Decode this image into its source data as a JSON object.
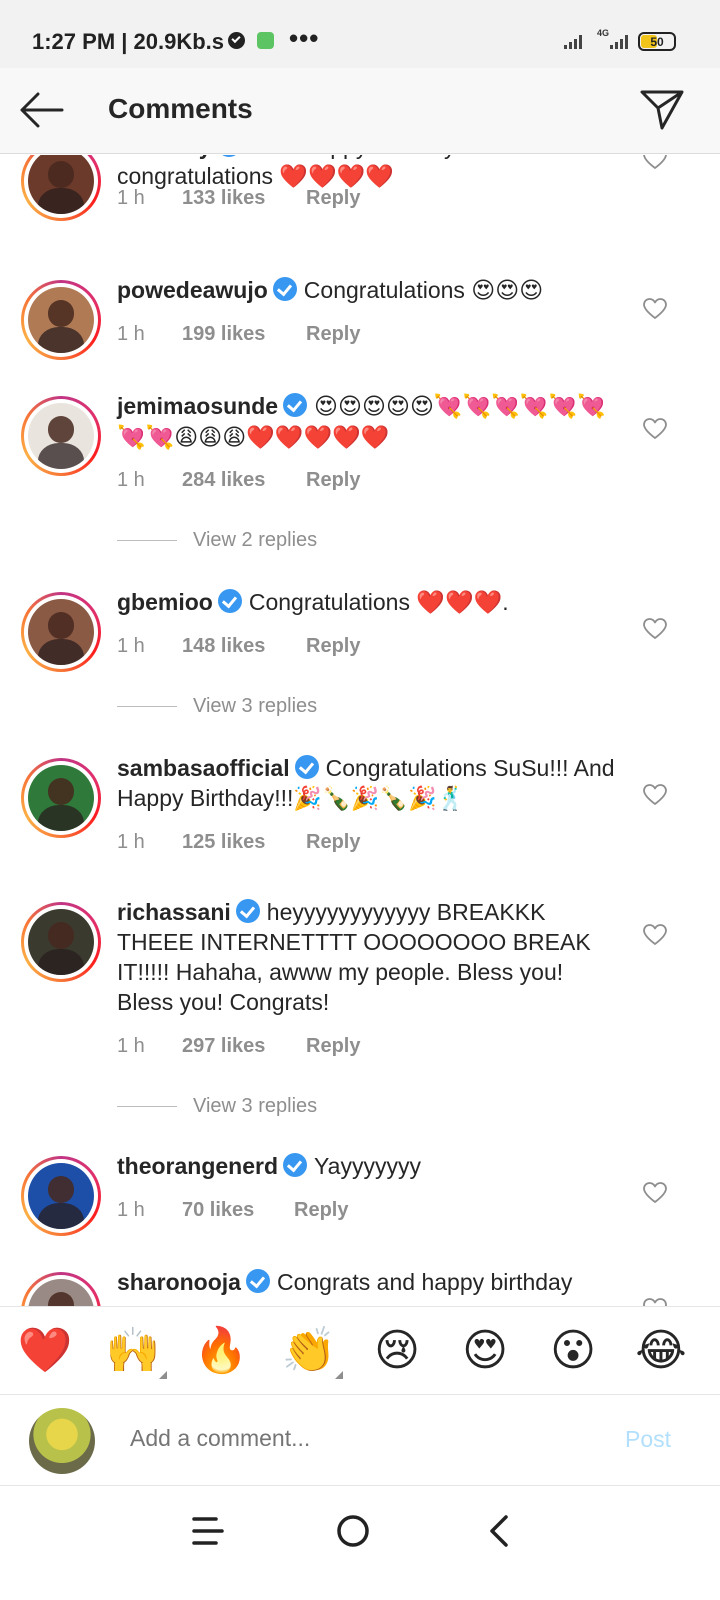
{
  "status_bar": {
    "time_and_speed": "1:27 PM | 20.9Kb.s",
    "more": "•••",
    "network": "4G",
    "battery": "50",
    "battery_level_percent": 50
  },
  "header": {
    "title": "Comments",
    "back_icon": "arrow-left-icon",
    "send_icon": "paper-plane-icon"
  },
  "comments": [
    {
      "username": "tolubally",
      "text": "Wow happy birthday beautiful and congratulations ",
      "emoji": "❤️❤️❤️❤️",
      "time": "1 h",
      "likes": "133 likes",
      "reply": "Reply",
      "avatar_color": "#6b3a2a"
    },
    {
      "username": "powedeawujo",
      "text": "Congratulations ",
      "emoji": "😍😍😍",
      "time": "1 h",
      "likes": "199 likes",
      "reply": "Reply",
      "avatar_color": "#b07a55"
    },
    {
      "username": "jemimaosunde",
      "text": "",
      "emoji": "😍😍😍😍😍💘💘💘💘💘💘💘💘😩😩😩❤️❤️❤️❤️❤️",
      "time": "1 h",
      "likes": "284 likes",
      "reply": "Reply",
      "avatar_color": "#e9e4dd"
    },
    {
      "username": "gbemioo",
      "text": "Congratulations ",
      "emoji": "❤️❤️❤️",
      "text_after": ".",
      "time": "1 h",
      "likes": "148 likes",
      "reply": "Reply",
      "avatar_color": "#8a5a45"
    },
    {
      "username": "sambasaofficial",
      "text": "Congratulations SuSu!!! And Happy Birthday!!!",
      "emoji": "🎉🍾🎉🍾🎉🕺",
      "time": "1 h",
      "likes": "125 likes",
      "reply": "Reply",
      "avatar_color": "#2f7a3a"
    },
    {
      "username": "richassani",
      "text": "heyyyyyyyyyyyy BREAKKK THEEE INTERNETTTT OOOOOOOO BREAK IT!!!!! Hahaha, awww my people. Bless you! Bless you! Congrats!",
      "emoji": "",
      "time": "1 h",
      "likes": "297 likes",
      "reply": "Reply",
      "avatar_color": "#3a3a2e"
    },
    {
      "username": "theorangenerd",
      "text": "Yayyyyyyy",
      "emoji": "",
      "time": "1 h",
      "likes": "70 likes",
      "reply": "Reply",
      "avatar_color": "#1e4fa8"
    },
    {
      "username": "sharonooja",
      "text": "Congrats and happy birthday",
      "emoji": "",
      "time": "",
      "likes": "",
      "reply": "",
      "avatar_color": "#9a8a85"
    }
  ],
  "view_replies": [
    {
      "label": "View 2 replies"
    },
    {
      "label": "View 3 replies"
    },
    {
      "label": "View 3 replies"
    }
  ],
  "reactions": [
    "❤️",
    "🙌",
    "🔥",
    "👏",
    "😢",
    "😍",
    "😮",
    "😂"
  ],
  "composer": {
    "placeholder": "Add a comment...",
    "post_label": "Post"
  },
  "nav": {
    "menu_icon": "menu-icon",
    "home_icon": "home-circle-icon",
    "back_icon": "back-chevron-icon"
  }
}
